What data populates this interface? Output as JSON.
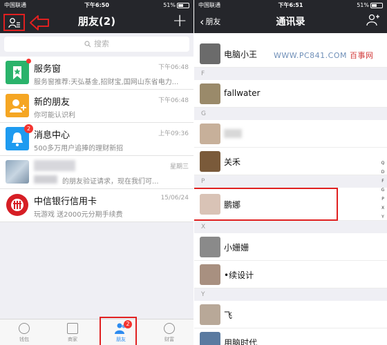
{
  "left": {
    "status": {
      "carrier": "中国联通",
      "time": "下午6:50",
      "battery": "51%"
    },
    "title": "朋友(2)",
    "plus_label": "+",
    "search_placeholder": "搜索",
    "chats": [
      {
        "name": "服务窗",
        "preview": "服务窗推荐:天弘基金,招财宝,国网山东省电力...",
        "time": "下午06:48",
        "color": "#2ab36b",
        "icon": "bookmark-star-icon"
      },
      {
        "name": "新的朋友",
        "preview": "你可能认识利",
        "time": "下午06:48",
        "color": "#f5a623",
        "icon": "add-person-icon"
      },
      {
        "name": "消息中心",
        "preview": "500多万用户追捧的理财新招",
        "time": "上午09:36",
        "color": "#1e9bf0",
        "icon": "bell-icon",
        "badge": "2"
      },
      {
        "name": "",
        "preview": "的朋友验证请求，现在我们可...",
        "time": "星期三",
        "color": "#9cb3c9",
        "icon": "photo-avatar"
      },
      {
        "name": "中信银行信用卡",
        "preview": "玩游戏 送2000元分期手续费",
        "time": "15/06/24",
        "color": "#d61e25",
        "icon": "citic-logo-icon"
      }
    ],
    "tabs": [
      {
        "label": "钱包",
        "icon": "wallet-icon"
      },
      {
        "label": "商家",
        "icon": "store-icon"
      },
      {
        "label": "朋友",
        "icon": "friends-icon",
        "badge": "2"
      },
      {
        "label": "财富",
        "icon": "wealth-icon"
      }
    ]
  },
  "right": {
    "status": {
      "carrier": "中国联通",
      "time": "下午6:51",
      "battery": "51%"
    },
    "back_label": "朋友",
    "title": "通讯录",
    "watermark_prefix": "WWW.PC841.COM",
    "watermark_suffix": "百事网",
    "rows": [
      {
        "type": "contact",
        "name": "电脑小王"
      },
      {
        "type": "section",
        "label": "F"
      },
      {
        "type": "contact",
        "name": "fallwater"
      },
      {
        "type": "section",
        "label": "G"
      },
      {
        "type": "contact",
        "name": ""
      },
      {
        "type": "contact",
        "name": "关禾"
      },
      {
        "type": "section",
        "label": "P"
      },
      {
        "type": "contact",
        "name": "鹏娜"
      },
      {
        "type": "section",
        "label": "X"
      },
      {
        "type": "contact",
        "name": "小姗姗"
      },
      {
        "type": "contact",
        "name": "•续设计"
      },
      {
        "type": "section",
        "label": "Y"
      },
      {
        "type": "contact",
        "name": "飞"
      },
      {
        "type": "contact",
        "name": "用脑时代"
      }
    ],
    "index_letters": [
      "Q",
      "D",
      "F",
      "G",
      "P",
      "X",
      "Y"
    ]
  }
}
